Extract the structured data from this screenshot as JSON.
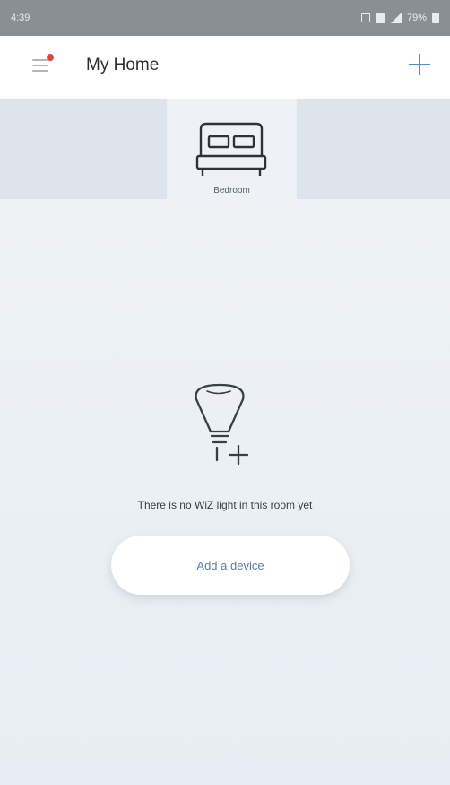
{
  "status_bar": {
    "time": "4:39",
    "battery": "79%"
  },
  "header": {
    "title": "My Home",
    "menu_icon": "menu-with-notification-icon",
    "add_icon": "plus-icon"
  },
  "rooms": [
    {
      "label": "Bedroom",
      "icon": "bed-icon"
    }
  ],
  "empty_state": {
    "icon": "bulb-add-icon",
    "message": "There is no WiZ light in this room yet",
    "button_label": "Add a device"
  },
  "colors": {
    "accent": "#5a8bc2",
    "notification": "#e0463a",
    "status_bar": "#8a8f94",
    "rooms_strip": "#dde5ec",
    "selected_room": "#eef2f6"
  }
}
